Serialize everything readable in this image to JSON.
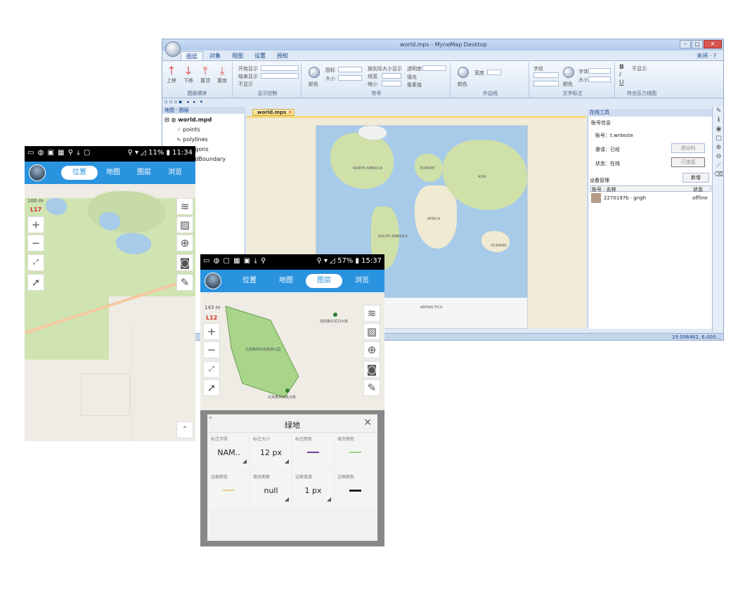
{
  "desktop": {
    "title": "world.mps - MyneMap Desktop",
    "tabs": [
      "图层",
      "对象",
      "视图",
      "设置",
      "授权"
    ],
    "tabs_right": "关闭 · ?",
    "ribbon": {
      "order_buttons": [
        "上移",
        "下移",
        "置顶",
        "置底"
      ],
      "order_group": "图层顺序",
      "display_group": "显示控制",
      "display_fields": [
        "开始显示",
        "结束显示",
        "不显示"
      ],
      "symbol_group": "符号",
      "symbol_fields": [
        "颜色",
        "图标",
        "大小",
        "填充",
        "按实际大小显示",
        "透明度",
        "线宽",
        "缩小",
        "像素值"
      ],
      "outline_group": "外边线",
      "outline_fields": [
        "颜色",
        "宽度"
      ],
      "text_group": "文字标注",
      "text_fields": [
        "字段",
        "颜色",
        "字体",
        "大小"
      ],
      "font_styles": [
        "B",
        "I",
        "U"
      ],
      "text_show": "不显示",
      "extra_group": "符合压力线图"
    },
    "layer_panel_title": "地图 · 图层",
    "layers": {
      "root": "world.mpd",
      "items": [
        "points",
        "polylines",
        "polygons",
        "worldBoundary"
      ]
    },
    "doc_tab": "world.mps",
    "map_labels": [
      "NORTH AMERICA",
      "SOUTH AMERICA",
      "EUROPE",
      "AFRICA",
      "ASIA",
      "OCEANIA",
      "ANTARCTICA"
    ],
    "online_panel": {
      "title": "在线工具",
      "account_section": "账号信息",
      "account": "账号：t.wnteste",
      "status": "邀请：已经",
      "status2": "状态：在线",
      "logout": "退出吗",
      "reload": "已连接",
      "device_section": "设备管理",
      "new_button": "新增",
      "col_name": "账号 · 名称",
      "col_status": "状态",
      "device_name": "2270197b · gngh",
      "device_status": "offline"
    },
    "coord": "19.006462, 6.000..."
  },
  "phone1": {
    "status_right": "⚲ ▾ ◿ 11% ▮ 11:34",
    "tabs": [
      "位置",
      "地图",
      "图层",
      "浏览"
    ],
    "active_tab": 0,
    "scale": "100 m",
    "level": "L17"
  },
  "phone2": {
    "status_right": "⚲ ▾ ◿ 57% ▮ 15:37",
    "tabs": [
      "位置",
      "地图",
      "图层",
      "浏览"
    ],
    "active_tab": 2,
    "scale": "143 m",
    "level": "L12",
    "map_labels": [
      "北京奥林匹克森林公园",
      "成府路中关村大街",
      "北京奥林匹克大街"
    ],
    "sheet": {
      "title": "绿地",
      "close": "✕",
      "cells": [
        {
          "label": "标注字段",
          "value": "NAM.."
        },
        {
          "label": "标注大小",
          "value": "12 px"
        },
        {
          "label": "标注颜色",
          "value": ""
        },
        {
          "label": "填充颜色",
          "value": ""
        },
        {
          "label": "边框颜色",
          "value": ""
        },
        {
          "label": "填充图案",
          "value": "null"
        },
        {
          "label": "边框宽度",
          "value": "1 px"
        },
        {
          "label": "边框颜色",
          "value": ""
        }
      ]
    }
  },
  "colors": {
    "accent": "#2a93df",
    "land": "#cfe0a9",
    "water": "#a7cbe8",
    "polygon": "#a8d58a",
    "label_purple": "#6a3fa0",
    "label_green": "#9bd48a",
    "label_yellow": "#e6d08a",
    "border_dark": "#222222"
  }
}
